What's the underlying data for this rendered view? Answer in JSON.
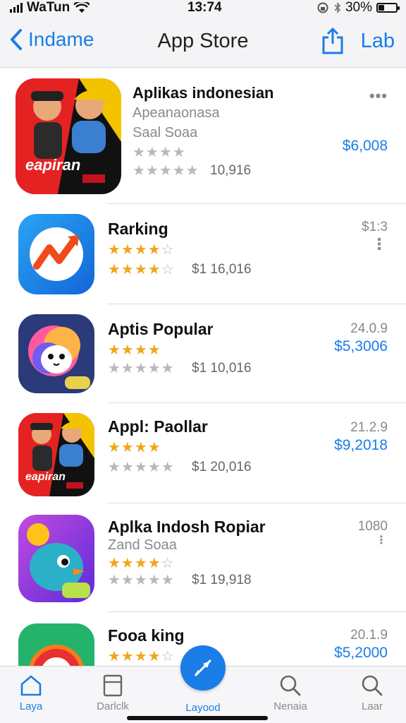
{
  "status": {
    "carrier": "WaTun",
    "time": "13:74",
    "battery_pct": "30%",
    "battery_level": 0.3
  },
  "nav": {
    "back_label": "Indame",
    "title": "App Store",
    "right_label": "Lab"
  },
  "apps": [
    {
      "name": "Aplikas indonesian",
      "sub1": "Apeanaonasa",
      "sub2": "Saal Soaa",
      "stars": 0,
      "count": "10,916",
      "price": "$6,008",
      "meta": "",
      "more": "•••",
      "icon": "comic-heroes-icon"
    },
    {
      "name": "Rarking",
      "sub1": "",
      "sub2": "",
      "stars": 4,
      "count": "$1 16,016",
      "price": "",
      "meta": "$1:3",
      "more": "⋮",
      "icon": "chart-arrow-icon"
    },
    {
      "name": "Aptis Popular",
      "sub1": "",
      "sub2": "",
      "stars": 4,
      "count": "$1 10,016",
      "price": "$5,3006",
      "meta": "24.0.9",
      "more": "",
      "icon": "cute-monster-icon"
    },
    {
      "name": "Appl: Paollar",
      "sub1": "",
      "sub2": "",
      "stars": 4,
      "count": "$1 20,016",
      "price": "$9,2018",
      "meta": "21.2.9",
      "more": "",
      "icon": "comic-heroes-icon"
    },
    {
      "name": "Aplka Indosh Ropiar",
      "sub1": "Zand Soaa",
      "sub2": "",
      "stars": 4,
      "count": "$1 19,918",
      "price": "",
      "meta": "1080",
      "more": "⋮",
      "icon": "blue-bird-icon"
    },
    {
      "name": "Fooa king",
      "sub1": "",
      "sub2": "",
      "stars": 4,
      "count": "",
      "price": "$5,2000",
      "meta": "20.1.9",
      "more": "",
      "icon": "ring-icon"
    }
  ],
  "tabs": [
    {
      "label": "Laya",
      "icon": "home-icon"
    },
    {
      "label": "Darlclk",
      "icon": "browse-icon"
    },
    {
      "label": "Layood",
      "icon": "compass-icon"
    },
    {
      "label": "Nenaia",
      "icon": "search-icon"
    },
    {
      "label": "Laar",
      "icon": "search-icon"
    }
  ],
  "colors": {
    "accent": "#1a7de8",
    "star": "#f1a51a"
  }
}
